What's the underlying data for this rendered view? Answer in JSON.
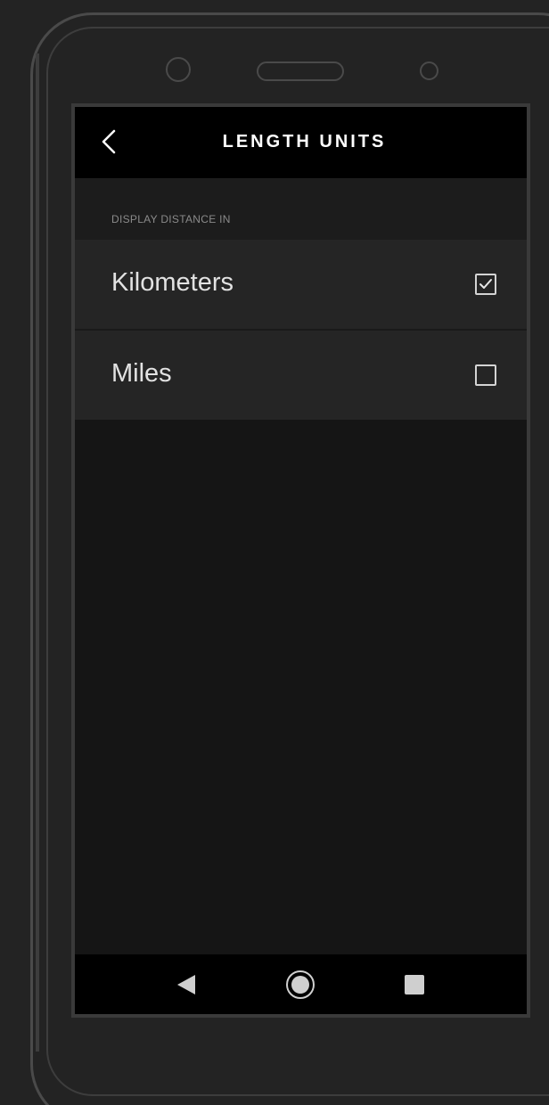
{
  "header": {
    "title": "LENGTH UNITS",
    "back_icon": "chevron-left-icon"
  },
  "section": {
    "label": "DISPLAY DISTANCE IN"
  },
  "options": [
    {
      "label": "Kilometers",
      "checked": true
    },
    {
      "label": "Miles",
      "checked": false
    }
  ],
  "nav": {
    "back_icon": "triangle-back-icon",
    "home_icon": "circle-home-icon",
    "recents_icon": "square-recents-icon"
  },
  "colors": {
    "background": "#232323",
    "screen_background": "#151515",
    "header_background": "#000000",
    "row_background": "#252525",
    "text_primary": "#e2e2e2",
    "text_secondary": "#8a8a8a"
  }
}
